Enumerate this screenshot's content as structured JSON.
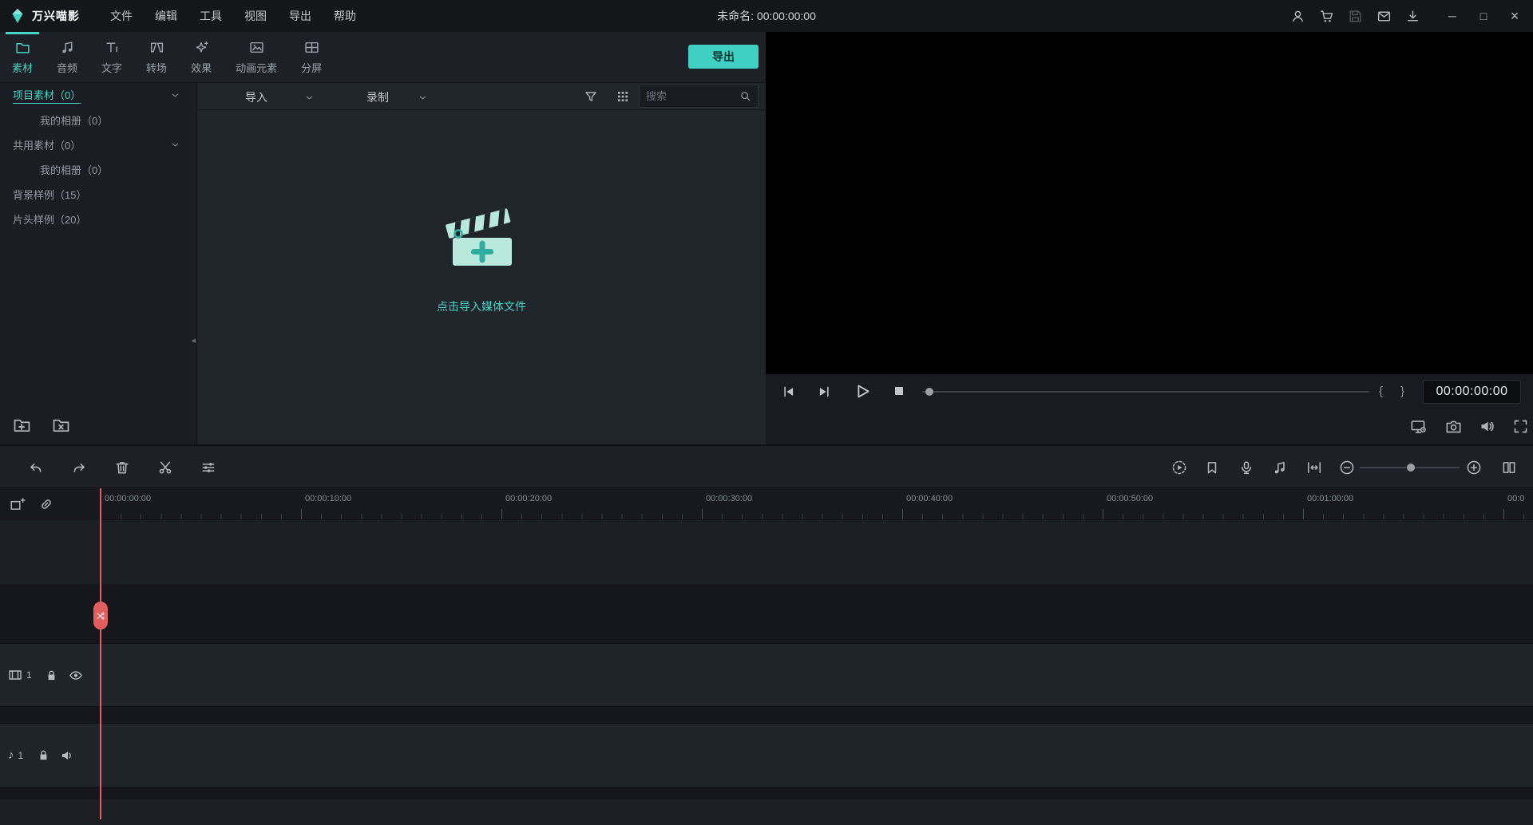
{
  "colors": {
    "accent": "#45d5c6",
    "playhead": "#e25d5d",
    "export_bg": "#3fd0c3"
  },
  "titlebar": {
    "app_name": "万兴喵影",
    "menus": [
      "文件",
      "编辑",
      "工具",
      "视图",
      "导出",
      "帮助"
    ],
    "project_title": "未命名: 00:00:00:00"
  },
  "panel_tabs": {
    "items": [
      "素材",
      "音频",
      "文字",
      "转场",
      "效果",
      "动画元素",
      "分屏"
    ],
    "active_index": 0,
    "export_label": "导出"
  },
  "sidebar": {
    "items": [
      {
        "label": "项目素材（0）"
      },
      {
        "label": "我的相册（0）"
      },
      {
        "label": "共用素材（0）"
      },
      {
        "label": "我的相册（0）"
      },
      {
        "label": "背景样例（15）"
      },
      {
        "label": "片头样例（20）"
      }
    ]
  },
  "browser": {
    "import_label": "导入",
    "record_label": "录制",
    "search_placeholder": "搜索",
    "empty_text": "点击导入媒体文件"
  },
  "preview": {
    "timecode": "00:00:00:00"
  },
  "timeline": {
    "ruler_labels": [
      "00:00:00:00",
      "00:00:10:00",
      "00:00:20:00",
      "00:00:30:00",
      "00:00:40:00",
      "00:00:50:00",
      "00:01:00:00",
      "00:0"
    ],
    "video_track_number": "1",
    "audio_track_number": "1"
  },
  "icons": {
    "note": "♪",
    "collapse": "◂",
    "minimize": "─",
    "maximize": "□",
    "close": "×",
    "mark_in": "{",
    "mark_out": "}"
  }
}
